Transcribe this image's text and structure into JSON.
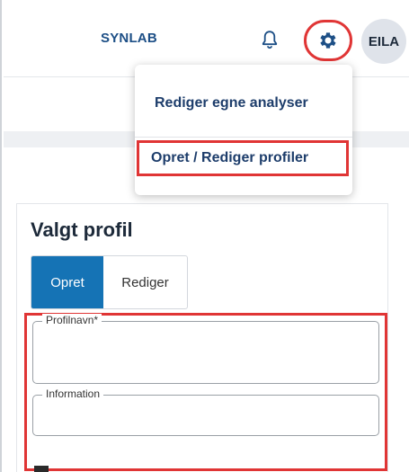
{
  "header": {
    "brand": "SYNLAB",
    "avatar_initials": "EILA",
    "icons": {
      "notifications": "bell-icon",
      "settings": "gear-icon"
    }
  },
  "dropdown": {
    "items": [
      {
        "label": "Rediger egne analyser"
      },
      {
        "label": "Opret / Rediger profiler"
      }
    ]
  },
  "profile": {
    "title": "Valgt profil",
    "tabs": {
      "create": "Opret",
      "edit": "Rediger",
      "active": "Opret"
    },
    "fields": {
      "name_label": "Profilnavn*",
      "name_value": "",
      "info_label": "Information",
      "info_value": ""
    }
  },
  "colors": {
    "accent": "#1573b5",
    "brand_text": "#1d4f86",
    "highlight": "#e03535"
  }
}
